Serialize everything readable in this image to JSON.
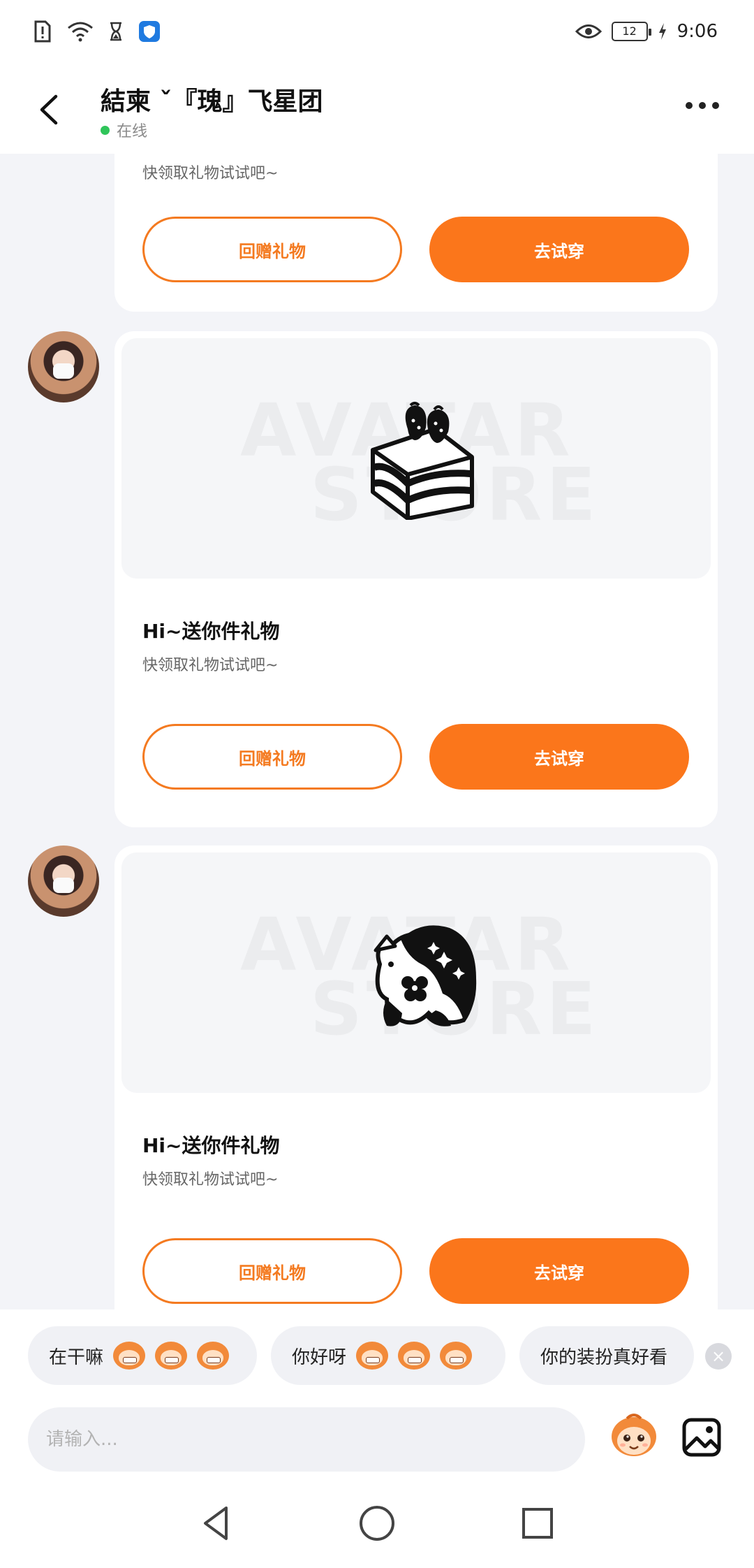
{
  "status_bar": {
    "time": "9:06",
    "battery": "12",
    "left_icons": [
      "sim-alert-icon",
      "wifi-icon",
      "hourglass-icon",
      "shield-app-icon"
    ],
    "right_icons": [
      "eye-icon",
      "battery-icon",
      "charging-icon"
    ]
  },
  "header": {
    "title": "結柬 ˇ『瑰』飞星团",
    "status": "在线",
    "status_color": "#2fc55a",
    "icons": [
      "back-arrow-icon",
      "more-icon"
    ]
  },
  "messages": [
    {
      "title": "",
      "subtitle": "快领取礼物试试吧~",
      "gift_icon": "",
      "reply_label": "回赠礼物",
      "try_label": "去试穿"
    },
    {
      "title": "Hi~送你件礼物",
      "subtitle": "快领取礼物试试吧~",
      "gift_icon": "cake-icon",
      "watermark": [
        "AVATAR",
        "STORE"
      ],
      "reply_label": "回赠礼物",
      "try_label": "去试穿"
    },
    {
      "title": "Hi~送你件礼物",
      "subtitle": "快领取礼物试试吧~",
      "gift_icon": "unicorn-icon",
      "watermark": [
        "AVATAR",
        "STORE"
      ],
      "reply_label": "回赠礼物",
      "try_label": "去试穿"
    }
  ],
  "quick_replies": [
    {
      "text": "在干嘛"
    },
    {
      "text": "你好呀"
    },
    {
      "text": "你的装扮真好看"
    }
  ],
  "input": {
    "placeholder": "请输入..."
  },
  "colors": {
    "accent": "#fb761b",
    "background": "#f3f4f8"
  },
  "nav_bar": [
    "back-triangle-icon",
    "home-circle-icon",
    "recents-square-icon"
  ]
}
